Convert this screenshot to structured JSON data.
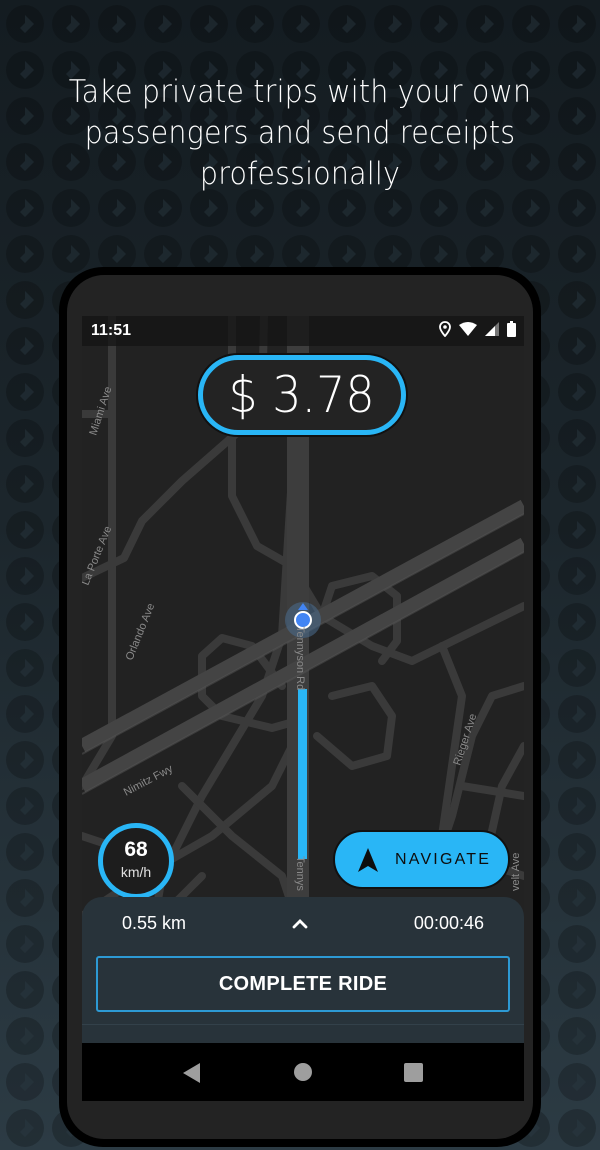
{
  "headline": {
    "lines": [
      "Take private trips with your own",
      "passengers and send receipts",
      "professionally"
    ]
  },
  "status_bar": {
    "time": "11:51",
    "icons": [
      "location-pin-icon",
      "wifi-icon",
      "cell-signal-icon",
      "battery-icon"
    ]
  },
  "fare": {
    "display": "$ 3.78"
  },
  "map": {
    "road_labels": [
      "Miami Ave",
      "La Porte Ave",
      "Orlando Ave",
      "Nimitz Fwy",
      "Tennyson Rd",
      "Tennys",
      "Rieger Ave",
      "velt Ave"
    ]
  },
  "speedometer": {
    "value": "68",
    "unit": "km/h"
  },
  "navigate_button": {
    "label": "NAVIGATE",
    "icon": "navigation-arrow-icon"
  },
  "trip_sheet": {
    "distance": "0.55 km",
    "elapsed": "00:00:46",
    "expand_icon": "chevron-up-icon",
    "complete_label": "COMPLETE RIDE"
  },
  "nav_bar": {
    "buttons": [
      "back",
      "home",
      "recents"
    ]
  },
  "colors": {
    "accent": "#29b6f6",
    "map_bg": "#222222",
    "road": "#3a3a3a",
    "sheet_bg": "#28333a",
    "location_dot": "#4285f4"
  }
}
